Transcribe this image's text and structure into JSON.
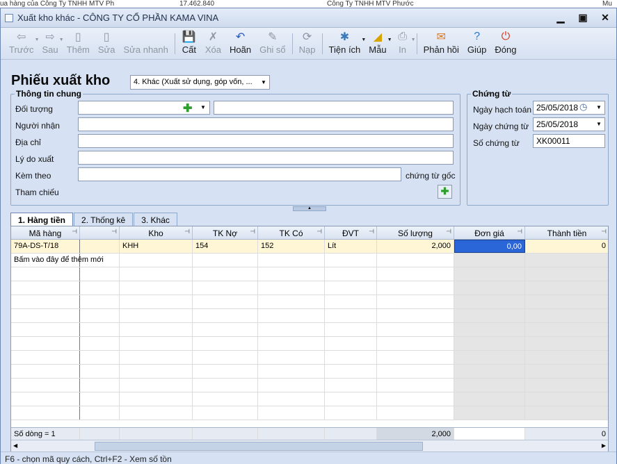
{
  "background_strip": [
    "ua hàng của Công Ty TNHH MTV Ph",
    "17.462.840",
    "Công Ty TNHH MTV Phước",
    "Mu"
  ],
  "window": {
    "title": "Xuất kho khác - CÔNG TY CỔ PHẦN KAMA VINA"
  },
  "toolbar": [
    {
      "label": "Trước",
      "icon": "arrow-left-icon",
      "glyph": "⇦",
      "enabled": false
    },
    {
      "label": "Sau",
      "icon": "arrow-right-icon",
      "glyph": "⇨",
      "enabled": false
    },
    {
      "label": "Thêm",
      "icon": "add-doc-icon",
      "glyph": "▯",
      "enabled": false
    },
    {
      "label": "Sửa",
      "icon": "edit-doc-icon",
      "glyph": "▯",
      "enabled": false
    },
    {
      "label": "Sửa nhanh",
      "icon": "quick-edit-icon",
      "glyph": "",
      "enabled": false
    },
    {
      "label": "Cất",
      "icon": "save-icon",
      "glyph": "💾",
      "enabled": true
    },
    {
      "label": "Xóa",
      "icon": "delete-icon",
      "glyph": "✗",
      "enabled": false
    },
    {
      "label": "Hoãn",
      "icon": "undo-icon",
      "glyph": "↶",
      "enabled": true
    },
    {
      "label": "Ghi sổ",
      "icon": "post-ledger-icon",
      "glyph": "✎",
      "enabled": false
    },
    {
      "label": "Nạp",
      "icon": "reload-icon",
      "glyph": "⟳",
      "enabled": false
    },
    {
      "label": "Tiện ích",
      "icon": "utilities-icon",
      "glyph": "✱",
      "enabled": true
    },
    {
      "label": "Mẫu",
      "icon": "template-icon",
      "glyph": "◢",
      "enabled": true
    },
    {
      "label": "In",
      "icon": "print-icon",
      "glyph": "⎙",
      "enabled": false
    },
    {
      "label": "Phản hồi",
      "icon": "feedback-mail-icon",
      "glyph": "✉",
      "enabled": true
    },
    {
      "label": "Giúp",
      "icon": "help-icon",
      "glyph": "?",
      "enabled": true
    },
    {
      "label": "Đóng",
      "icon": "close-power-icon",
      "glyph": "⏻",
      "enabled": true
    }
  ],
  "form": {
    "heading": "Phiếu xuất kho",
    "type_select": "4. Khác (Xuất sử dụng, góp vốn, ...",
    "general_group": "Thông tin chung",
    "labels": {
      "doi_tuong": "Đối tượng",
      "nguoi_nhan": "Người nhận",
      "dia_chi": "Địa chỉ",
      "ly_do": "Lý do xuất",
      "kem_theo": "Kèm theo",
      "tham_chieu": "Tham chiếu",
      "chung_tu_goc": "chứng từ gốc"
    },
    "values": {
      "doi_tuong": "",
      "doi_tuong_name": "",
      "nguoi_nhan": "",
      "dia_chi": "",
      "ly_do": "",
      "kem_theo": ""
    }
  },
  "voucher": {
    "group": "Chứng từ",
    "labels": {
      "ngay_hach_toan": "Ngày hạch toán",
      "ngay_chung_tu": "Ngày chứng từ",
      "so_chung_tu": "Số chứng từ"
    },
    "values": {
      "ngay_hach_toan": "25/05/2018",
      "ngay_chung_tu": "25/05/2018",
      "so_chung_tu": "XK00011"
    }
  },
  "tabs": [
    {
      "label": "1. Hàng tiền",
      "active": true
    },
    {
      "label": "2. Thống kê",
      "active": false
    },
    {
      "label": "3. Khác",
      "active": false
    }
  ],
  "grid": {
    "columns": [
      "Mã hàng",
      "",
      "Kho",
      "TK Nợ",
      "TK Có",
      "ĐVT",
      "Số lượng",
      "Đơn giá",
      "Thành tiền"
    ],
    "rows": [
      {
        "ma_hang": "79A-DS-T/18",
        "c2": "",
        "kho": "KHH",
        "tk_no": "154",
        "tk_co": "152",
        "dvt": "Lít",
        "so_luong": "2,000",
        "don_gia": "0,00",
        "thanh_tien": "0"
      }
    ],
    "add_row_text": "Bấm vào đây để thêm mới",
    "footer": {
      "count": "Số dòng = 1",
      "so_luong_total": "2,000",
      "thanh_tien_total": "0"
    }
  },
  "status_bar": "F6 - chọn mã quy cách, Ctrl+F2 - Xem số tồn",
  "colors": {
    "selected_row": "#fff6d5",
    "selected_cell": "#2b66d9",
    "disabled_col": "#e5e5e5"
  }
}
